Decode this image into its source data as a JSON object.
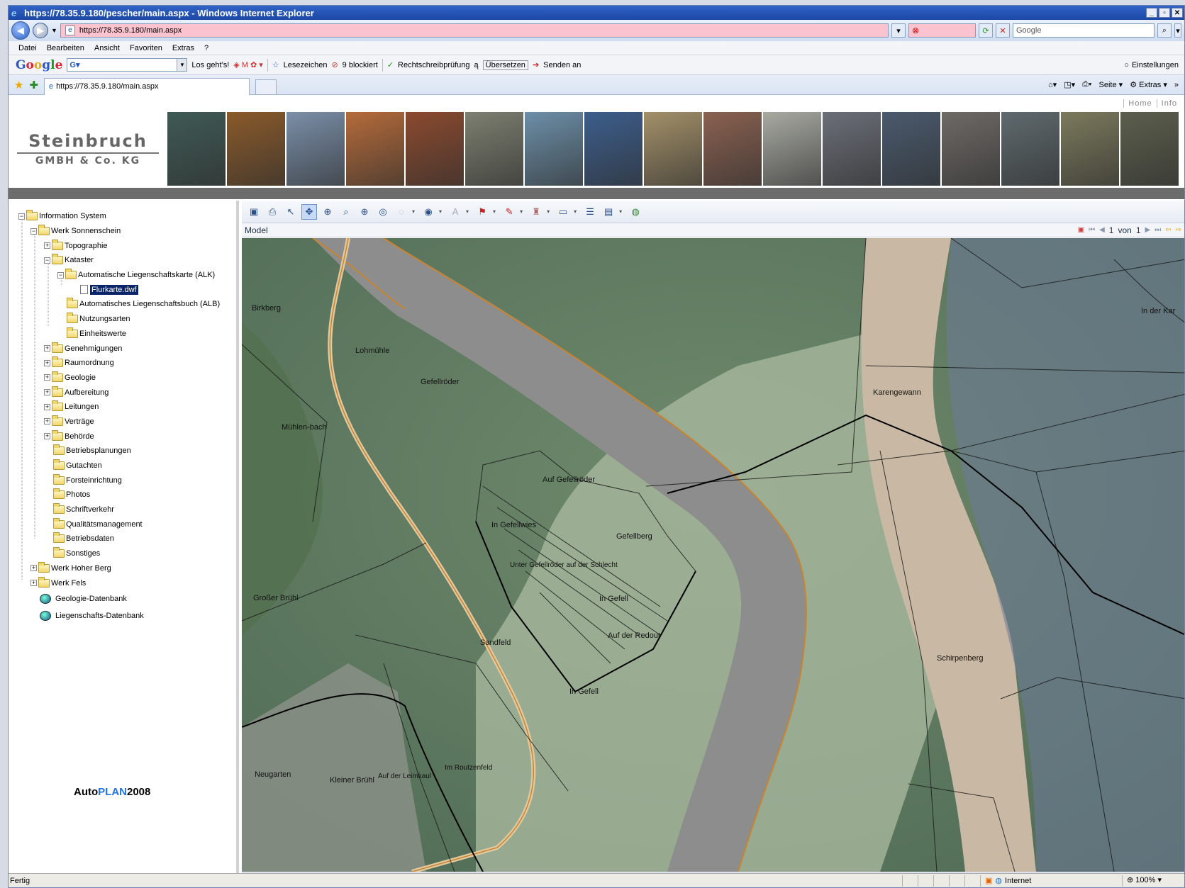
{
  "browser": {
    "title": "https://78.35.9.180/pescher/main.aspx - Windows Internet Explorer",
    "address": "https://78.35.9.180/main.aspx",
    "search_placeholder": "Google",
    "tab_label": "https://78.35.9.180/main.aspx",
    "menu": [
      "Datei",
      "Bearbeiten",
      "Ansicht",
      "Favoriten",
      "Extras",
      "?"
    ],
    "google_toolbar": {
      "go": "Los geht's!",
      "bookmarks": "Lesezeichen",
      "blocked": "9 blockiert",
      "spellcheck": "Rechtschreibprüfung",
      "translate": "Übersetzen",
      "send": "Senden an",
      "settings": "Einstellungen"
    },
    "tab_tools": {
      "page": "Seite",
      "extras": "Extras"
    },
    "status": {
      "left": "Fertig",
      "zone": "Internet",
      "zoom": "100%"
    }
  },
  "site": {
    "top_links": [
      "Home",
      "Info"
    ],
    "logo_line1": "Steinbruch",
    "logo_line2": "GMBH & Co. KG",
    "photo_colors": [
      "#3f5a55",
      "#8a5a2a",
      "#7a8fa8",
      "#b56b3a",
      "#8b4a2e",
      "#7d7f70",
      "#6c8fa8",
      "#3c5e8c",
      "#a39068",
      "#8a6150",
      "#a8aaa2",
      "#6b6f78",
      "#4a5a6e",
      "#6e6a66",
      "#5f6a6e",
      "#7c7a5c",
      "#5c5f4c"
    ],
    "autoplan": {
      "a": "Auto",
      "b": "PLAN",
      "c": "2008"
    }
  },
  "tree": {
    "root": "Information System",
    "werk1": "Werk Sonnenschein",
    "topo": "Topographie",
    "kataster": "Kataster",
    "alk": "Automatische Liegenschaftskarte (ALK)",
    "flurkarte": "Flurkarte.dwf",
    "alb": "Automatisches Liegenschaftsbuch (ALB)",
    "nutz": "Nutzungsarten",
    "einheit": "Einheitswerte",
    "genehm": "Genehmigungen",
    "raum": "Raumordnung",
    "geologie": "Geologie",
    "aufb": "Aufbereitung",
    "leit": "Leitungen",
    "vert": "Verträge",
    "beh": "Behörde",
    "betriebsplan": "Betriebsplanungen",
    "gutachten": "Gutachten",
    "forst": "Forsteinrichtung",
    "photos": "Photos",
    "schrift": "Schriftverkehr",
    "quali": "Qualitätsmanagement",
    "betriebsdaten": "Betriebsdaten",
    "sonst": "Sonstiges",
    "werk2": "Werk Hoher Berg",
    "werk3": "Werk Fels",
    "geodb": "Geologie-Datenbank",
    "liegdb": "Liegenschafts-Datenbank"
  },
  "viewer": {
    "tab": "Model",
    "page": "1",
    "of_label": "von",
    "total": "1",
    "map_labels": {
      "birkberg": "Birkberg",
      "lohmuehle": "Lohmühle",
      "gefellroeder": "Gefellröder",
      "muehlenbach": "Mühlen-bach",
      "auf_gefellroeder": "Auf Gefellröder",
      "in_gefellwies": "In Gefellwies",
      "gefellberg": "Gefellberg",
      "unter_gefellroeder": "Unter Gefellröder auf der Schlecht",
      "in_gefell": "In Gefell",
      "in_gefell2": "In Gefell",
      "auf_der_redout": "Auf der Redout",
      "grosser_bruehl": "Großer Brühl",
      "sandfeld": "Sandfeld",
      "karengewann": "Karengewann",
      "schirpenberg": "Schirpenberg",
      "in_der_kar": "In der Kar",
      "neugarten": "Neugarten",
      "kleiner_bruehl": "Kleiner Brühl",
      "auf_der_leimkaul": "Auf der Leimkaul",
      "im_routzenfeld": "Im Routzenfeld"
    }
  }
}
